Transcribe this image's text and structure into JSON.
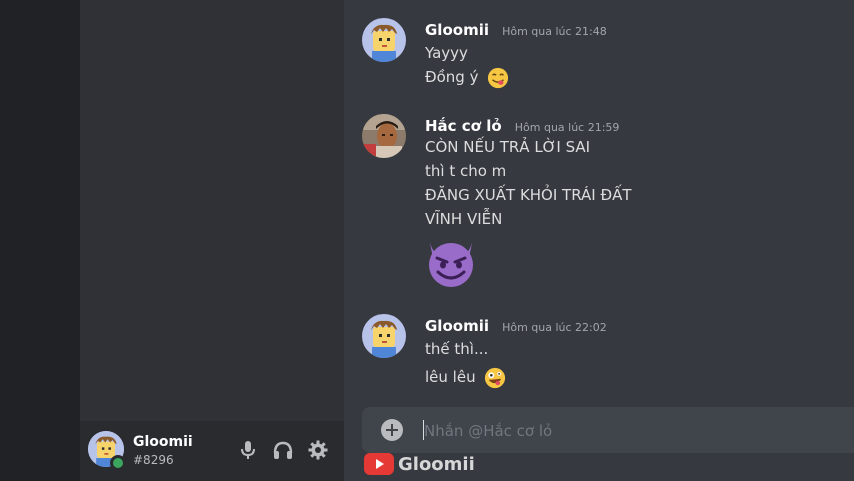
{
  "user_panel": {
    "username": "Gloomii",
    "tag": "#8296"
  },
  "messages": [
    {
      "author": "Gloomii",
      "timestamp": "Hôm qua lúc 21:48",
      "lines": [
        "Yayyy",
        "Đồng ý"
      ],
      "emoji": "yum-face-icon"
    },
    {
      "author": "Hắc cơ lỏ",
      "timestamp": "Hôm qua lúc 21:59",
      "lines": [
        "CÒN NẾU TRẢ LỜI SAI",
        "thì t cho m",
        "ĐĂNG XUẤT KHỎI TRÁI ĐẤT",
        "VĨNH VIỄN"
      ],
      "emoji": "smiling-imp-icon"
    },
    {
      "author": "Gloomii",
      "timestamp": "Hôm qua lúc 22:02",
      "lines": [
        "thế thì...",
        "lêu lêu"
      ],
      "emoji": "zany-face-icon"
    }
  ],
  "composer": {
    "placeholder": "Nhắn @Hắc cơ lỏ"
  },
  "watermark": {
    "text": "Gloomii"
  },
  "colors": {
    "chat_bg": "#36393f",
    "sidebar_bg": "#2f3136",
    "rail_bg": "#202225",
    "online": "#3ba55d"
  }
}
